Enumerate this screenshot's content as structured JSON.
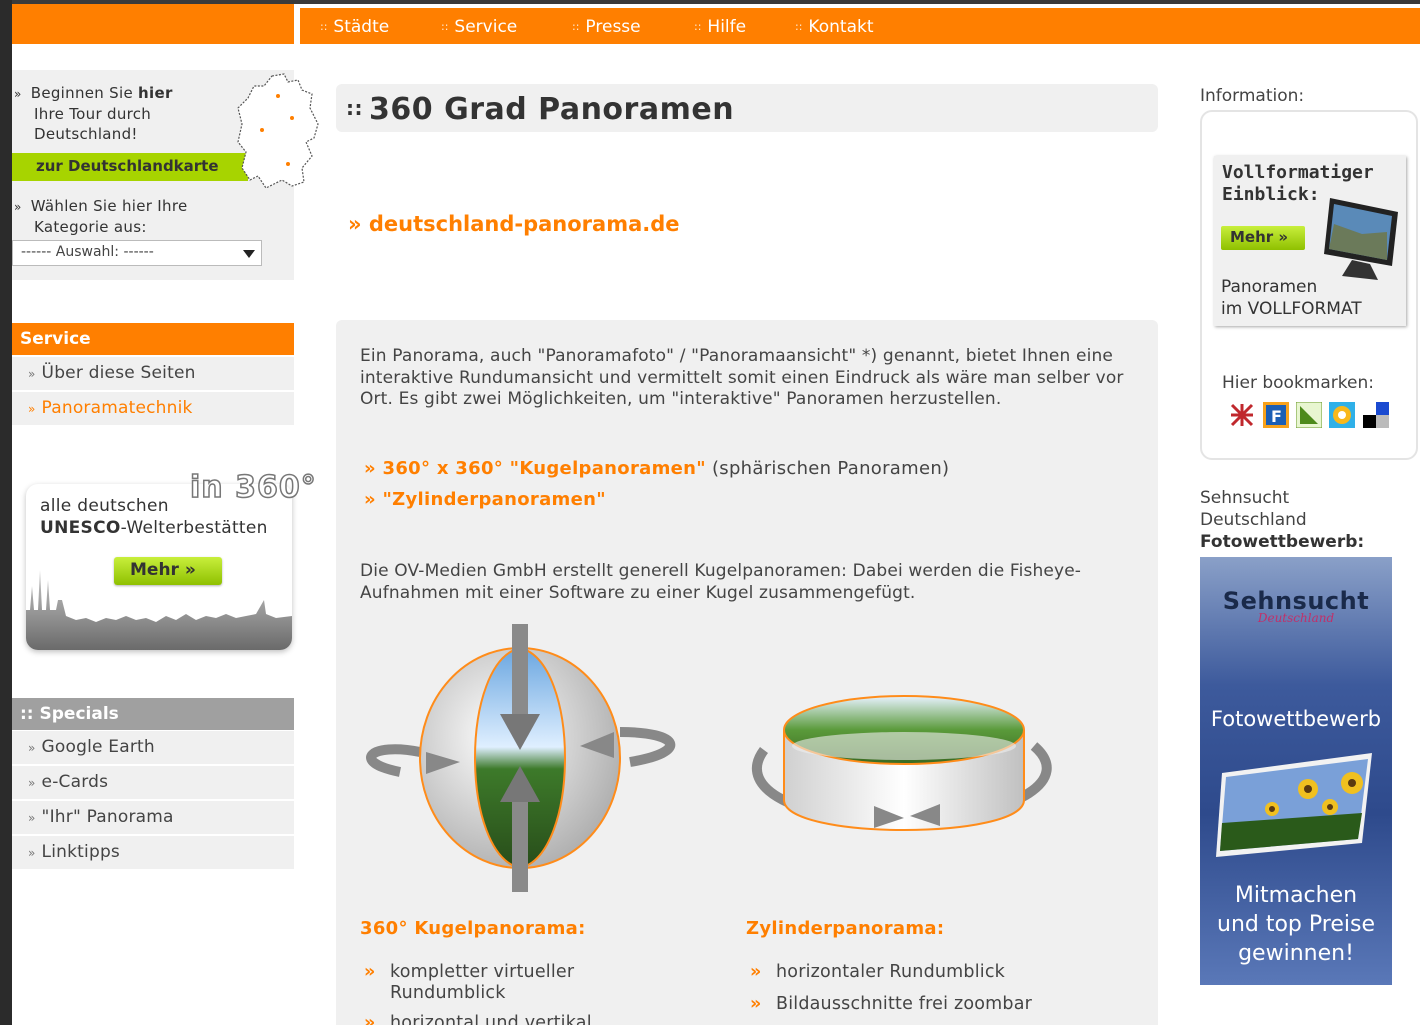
{
  "nav": {
    "items": [
      {
        "label": "Städte"
      },
      {
        "label": "Service"
      },
      {
        "label": "Presse"
      },
      {
        "label": "Hilfe"
      },
      {
        "label": "Kontakt"
      }
    ],
    "separator": "::"
  },
  "left": {
    "tour_prefix": "Beginnen Sie ",
    "tour_bold": "hier",
    "tour_line2": "Ihre Tour durch",
    "tour_line3": "Deutschland!",
    "map_button": "zur Deutschlandkarte",
    "category_line1": "Wählen Sie hier Ihre",
    "category_line2": "Kategorie aus:",
    "select_value": "------ Auswahl: ------",
    "service_head": "Service",
    "service_items": [
      {
        "label": "Über diese Seiten"
      },
      {
        "label": "Panoramatechnik"
      }
    ],
    "unesco_badge": "in 360°",
    "unesco_line1": "alle deutschen",
    "unesco_bold": "UNESCO",
    "unesco_rest": "-Welterbestätten",
    "unesco_button": "Mehr »",
    "specials_head": ":: Specials",
    "specials_items": [
      {
        "label": "Google Earth"
      },
      {
        "label": "e-Cards"
      },
      {
        "label": "\"Ihr\" Panorama"
      },
      {
        "label": "Linktipps"
      }
    ],
    "raquo": "»"
  },
  "main": {
    "title_dots": "::",
    "title": "360 Grad Panoramen",
    "site_link": "» deutschland-panorama.de",
    "intro": "Ein Panorama, auch \"Panoramafoto\" / \"Panoramaansicht\" *) genannt, bietet Ihnen eine interaktive Rundumansicht und vermittelt somit einen Eindruck als wäre man selber vor Ort. Es gibt zwei Möglichkeiten, um \"interaktive\" Panoramen herzustellen.",
    "link1": "» 360° x 360° \"Kugelpanoramen\"",
    "link1_suffix": " (sphärischen Panoramen)",
    "link2": "» \"Zylinderpanoramen\"",
    "para2": "Die OV-Medien GmbH erstellt generell Kugelpanoramen: Dabei werden die Fisheye-Aufnahmen mit einer Software zu einer Kugel zusammengefügt.",
    "kugel_head": "360° Kugelpanorama:",
    "kugel_bullets": [
      "kompletter virtueller Rundumblick",
      "horizontal und vertikal"
    ],
    "zyl_head": "Zylinderpanorama:",
    "zyl_bullets": [
      "horizontaler Rundumblick",
      "Bildausschnitte frei zoombar"
    ],
    "bullet_mark": "»"
  },
  "right": {
    "info_label": "Information:",
    "voll_title_1": "Vollformatiger",
    "voll_title_2": "Einblick:",
    "voll_button": "Mehr »",
    "voll_text_1": "Panoramen",
    "voll_text_2": "im VOLLFORMAT",
    "bookmark_label": "Hier bookmarken:",
    "sehn_line1": "Sehnsucht",
    "sehn_line2": "Deutschland",
    "sehn_line3": "Fotowettbewerb:",
    "banner_title": "Sehnsucht",
    "banner_script": "Deutschland",
    "banner_sub": "Fotowettbewerb",
    "banner_cta_1": "Mitmachen",
    "banner_cta_2": "und top Preise",
    "banner_cta_3": "gewinnen!"
  },
  "colors": {
    "accent": "#ff7f00",
    "green": "#a7d400",
    "gray_head": "#a0a0a0",
    "panel": "#f0f0f0"
  }
}
